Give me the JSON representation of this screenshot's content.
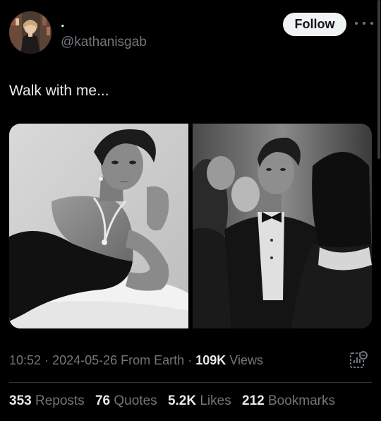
{
  "author": {
    "display_name": ".",
    "handle": "@kathanisgab"
  },
  "follow_label": "Follow",
  "tweet_text": "Walk with me...",
  "meta": {
    "time": "10:52",
    "date": "2024-05-26",
    "location": "From Earth",
    "views_count": "109K",
    "views_label": "Views",
    "separator": "·"
  },
  "stats": {
    "reposts_count": "353",
    "reposts_label": "Reposts",
    "quotes_count": "76",
    "quotes_label": "Quotes",
    "likes_count": "5.2K",
    "likes_label": "Likes",
    "bookmarks_count": "212",
    "bookmarks_label": "Bookmarks"
  },
  "icons": {
    "more": "more-horizontal-icon",
    "analytics": "analytics-icon"
  },
  "colors": {
    "background": "#000000",
    "text_primary": "#e7e9ea",
    "text_secondary": "#71767b",
    "follow_bg": "#eff3f4",
    "divider": "#2f3336"
  }
}
